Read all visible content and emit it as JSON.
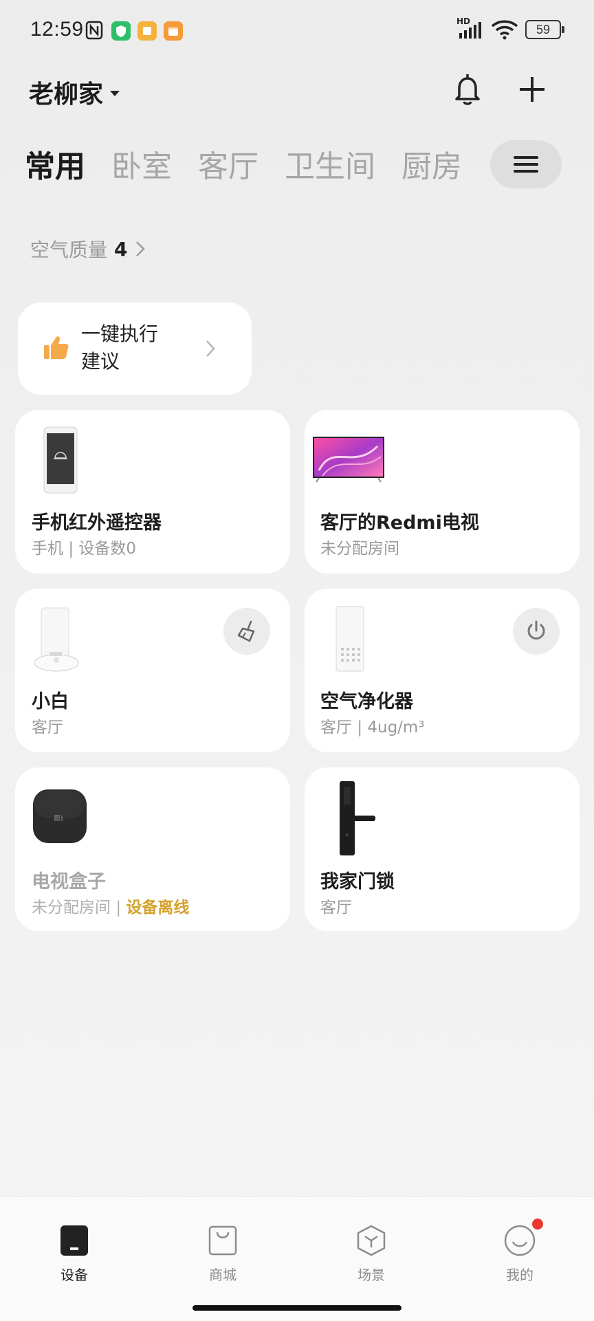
{
  "status_bar": {
    "time": "12:59",
    "battery": "59",
    "signal_label": "HD",
    "icons": [
      "nfc-icon",
      "shield-app-icon",
      "note-app-icon",
      "calendar-app-icon"
    ],
    "colors": {
      "green_app": "#2fbf6a",
      "yellow_app": "#f4b13b",
      "orange_app": "#f59b3a"
    }
  },
  "header": {
    "home_name": "老柳家",
    "bell_icon": "bell-icon",
    "add_icon": "plus-icon"
  },
  "tabs": [
    {
      "label": "常用",
      "active": true
    },
    {
      "label": "卧室",
      "active": false
    },
    {
      "label": "客厅",
      "active": false
    },
    {
      "label": "卫生间",
      "active": false
    },
    {
      "label": "厨房",
      "active": false
    }
  ],
  "air_quality": {
    "label": "空气质量",
    "value": "4"
  },
  "suggestion": {
    "line1": "一键执行",
    "line2": "建议",
    "icon": "thumbs-up-icon",
    "accent": "#f6a94a"
  },
  "devices": [
    {
      "name": "手机红外遥控器",
      "room": "手机",
      "extra": "设备数0",
      "icon": "phone-device-image"
    },
    {
      "name": "客厅的Redmi电视",
      "room": "未分配房间",
      "extra": "",
      "icon": "tv-device-image"
    },
    {
      "name": "小白",
      "room": "客厅",
      "extra": "",
      "icon": "robot-vacuum-image",
      "action": "sweep-icon"
    },
    {
      "name": "空气净化器",
      "room": "客厅",
      "extra": "4ug/m³",
      "icon": "air-purifier-image",
      "action": "power-icon"
    },
    {
      "name": "电视盒子",
      "room": "未分配房间",
      "extra": "设备离线",
      "icon": "tv-box-image",
      "offline": true
    },
    {
      "name": "我家门锁",
      "room": "客厅",
      "extra": "",
      "icon": "door-lock-image"
    }
  ],
  "separator": "|",
  "bottom_nav": [
    {
      "label": "设备",
      "active": true,
      "icon": "device-icon"
    },
    {
      "label": "商城",
      "active": false,
      "icon": "shop-bag-icon"
    },
    {
      "label": "场景",
      "active": false,
      "icon": "scene-cube-icon"
    },
    {
      "label": "我的",
      "active": false,
      "icon": "profile-smile-icon",
      "badge": true
    }
  ],
  "colors": {
    "badge": "#e8382f",
    "offline": "#d4a22c"
  }
}
